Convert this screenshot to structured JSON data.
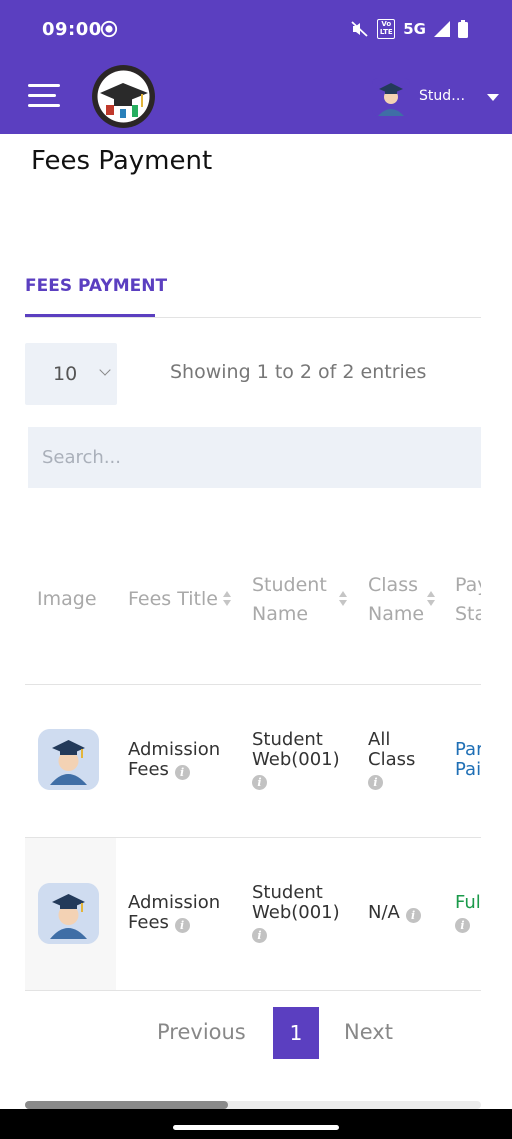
{
  "status_bar": {
    "time": "09:00",
    "network": "5G",
    "volte": "Vo LTE"
  },
  "app_bar": {
    "user_name": "Student Web"
  },
  "page": {
    "title": "Fees Payment"
  },
  "tabs": [
    {
      "label": "FEES PAYMENT",
      "active": true
    }
  ],
  "table_controls": {
    "page_length": "10",
    "info": "Showing 1 to 2 of 2 entries",
    "search_placeholder": "Search..."
  },
  "table": {
    "headers": {
      "image": "Image",
      "fees_title": "Fees Title",
      "student_name_1": "Student",
      "student_name_2": "Name",
      "class_name_1": "Class",
      "class_name_2": "Name",
      "payment_status_1": "Payment",
      "payment_status_2": "Status"
    },
    "rows": [
      {
        "fees_title_1": "Admission",
        "fees_title_2": "Fees",
        "student_1": "Student",
        "student_2": "Web(001)",
        "class_1": "All",
        "class_2": "Class",
        "status_1": "Partially",
        "status_2": "Paid",
        "status_color": "#1f6fb5"
      },
      {
        "fees_title_1": "Admission",
        "fees_title_2": "Fees",
        "student_1": "Student",
        "student_2": "Web(001)",
        "class_1": "N/A",
        "status_1": "Fully Paid",
        "status_color": "#1a9a4a"
      }
    ]
  },
  "pagination": {
    "previous": "Previous",
    "current": "1",
    "next": "Next"
  },
  "colors": {
    "primary": "#5b3fc0",
    "partial": "#1f6fb5",
    "full": "#1a9a4a"
  }
}
